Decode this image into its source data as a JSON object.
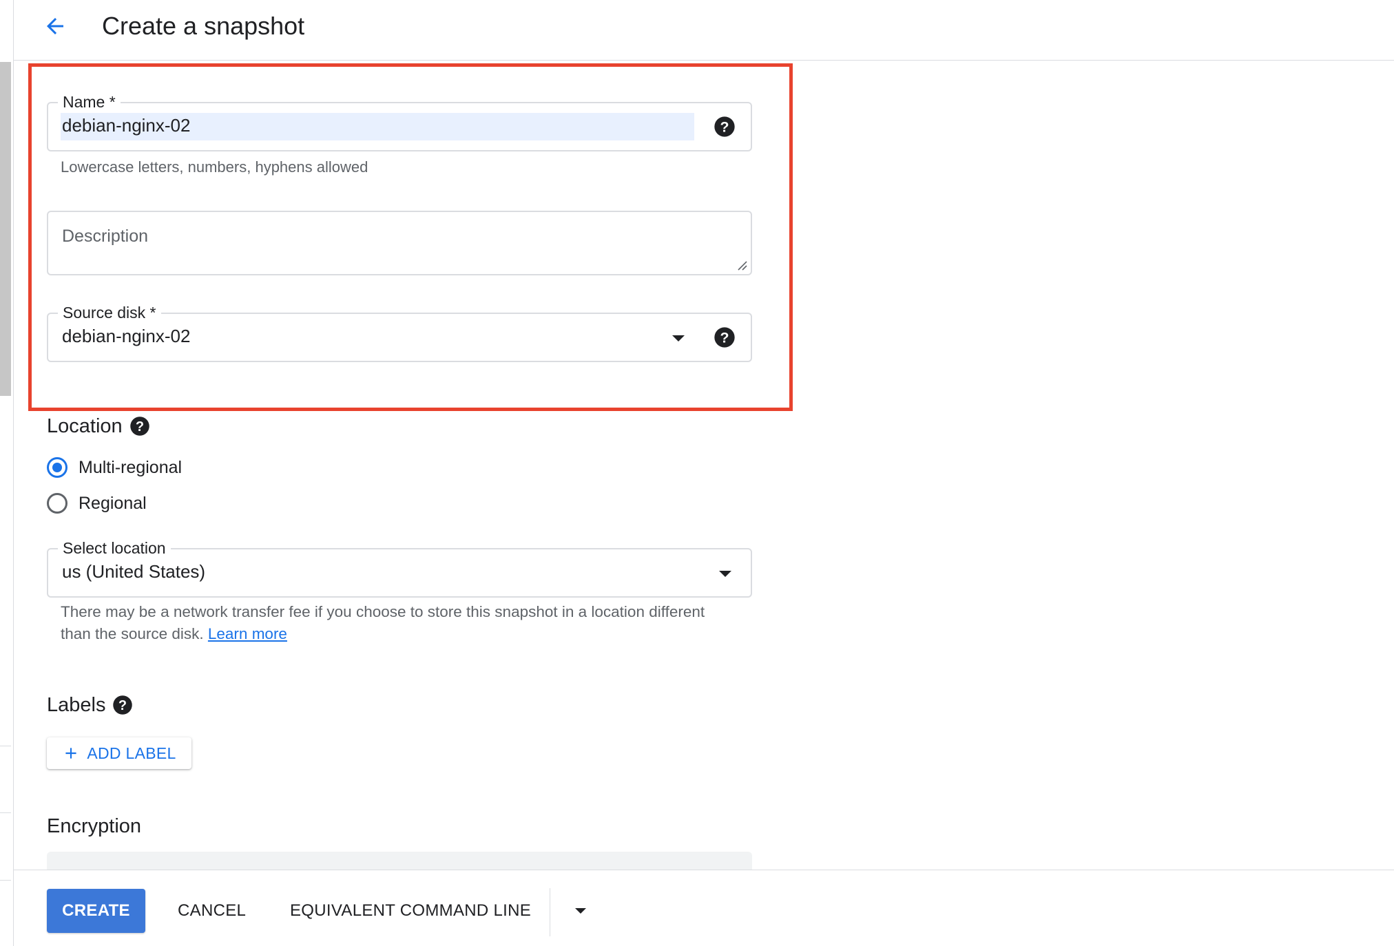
{
  "header": {
    "title": "Create a snapshot",
    "back_icon": "arrow-back-icon"
  },
  "form": {
    "name": {
      "label": "Name *",
      "value": "debian-nginx-02",
      "hint": "Lowercase letters, numbers, hyphens allowed"
    },
    "description": {
      "placeholder": "Description"
    },
    "source_disk": {
      "label": "Source disk *",
      "value": "debian-nginx-02"
    }
  },
  "location": {
    "heading": "Location",
    "options": [
      {
        "label": "Multi-regional",
        "selected": true
      },
      {
        "label": "Regional",
        "selected": false
      }
    ],
    "select": {
      "label": "Select location",
      "value": "us (United States)"
    },
    "note": "There may be a network transfer fee if you choose to store this snapshot in a location different than the source disk.",
    "learn_more": "Learn more"
  },
  "labels": {
    "heading": "Labels",
    "add_label": "ADD LABEL"
  },
  "encryption": {
    "heading": "Encryption"
  },
  "footer": {
    "create": "CREATE",
    "cancel": "CANCEL",
    "command_line": "EQUIVALENT COMMAND LINE"
  },
  "colors": {
    "accent": "#1a73e8",
    "primary_button": "#3c78d8",
    "highlight": "#e8432e",
    "selection": "#e8f0fe"
  }
}
